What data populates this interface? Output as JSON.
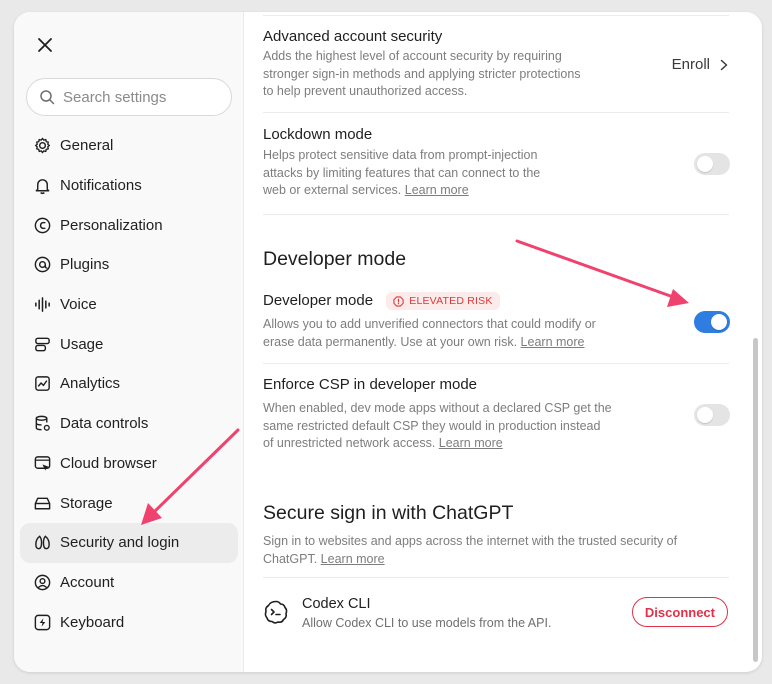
{
  "sidebar": {
    "search_placeholder": "Search settings",
    "items": [
      {
        "label": "General",
        "icon": "gear-icon"
      },
      {
        "label": "Notifications",
        "icon": "bell-icon"
      },
      {
        "label": "Personalization",
        "icon": "personalization-icon"
      },
      {
        "label": "Plugins",
        "icon": "plugins-icon"
      },
      {
        "label": "Voice",
        "icon": "waveform-icon"
      },
      {
        "label": "Usage",
        "icon": "usage-icon"
      },
      {
        "label": "Analytics",
        "icon": "analytics-icon"
      },
      {
        "label": "Data controls",
        "icon": "database-gear-icon"
      },
      {
        "label": "Cloud browser",
        "icon": "cloud-browser-icon"
      },
      {
        "label": "Storage",
        "icon": "storage-icon"
      },
      {
        "label": "Security and login",
        "icon": "security-icon",
        "active": true
      },
      {
        "label": "Account",
        "icon": "account-icon"
      },
      {
        "label": "Keyboard",
        "icon": "keyboard-icon"
      }
    ]
  },
  "security": {
    "advanced": {
      "title": "Advanced account security",
      "desc": "Adds the highest level of account security by requiring stronger sign-in methods and applying stricter protections to help prevent unauthorized access.",
      "action": "Enroll"
    },
    "lockdown": {
      "title": "Lockdown mode",
      "desc": "Helps protect sensitive data from prompt-injection attacks by limiting features that can connect to the web or external services.",
      "link": "Learn more",
      "enabled": false
    }
  },
  "developer": {
    "heading": "Developer mode",
    "mode": {
      "title": "Developer mode",
      "badge": "ELEVATED RISK",
      "desc": "Allows you to add unverified connectors that could modify or erase data permanently. Use at your own risk.",
      "link": "Learn more",
      "enabled": true
    },
    "csp": {
      "title": "Enforce CSP in developer mode",
      "desc": "When enabled, dev mode apps without a declared CSP get the same restricted default CSP they would in production instead of unrestricted network access.",
      "link": "Learn more",
      "enabled": false
    }
  },
  "signin": {
    "heading": "Secure sign in with ChatGPT",
    "desc": "Sign in to websites and apps across the internet with the trusted security of ChatGPT.",
    "link": "Learn more",
    "app": {
      "name": "Codex CLI",
      "desc": "Allow Codex CLI to use models from the API.",
      "button": "Disconnect"
    }
  },
  "colors": {
    "accent": "#2f7de1",
    "danger": "#e0314b",
    "annotation_arrow": "#f0426e"
  }
}
